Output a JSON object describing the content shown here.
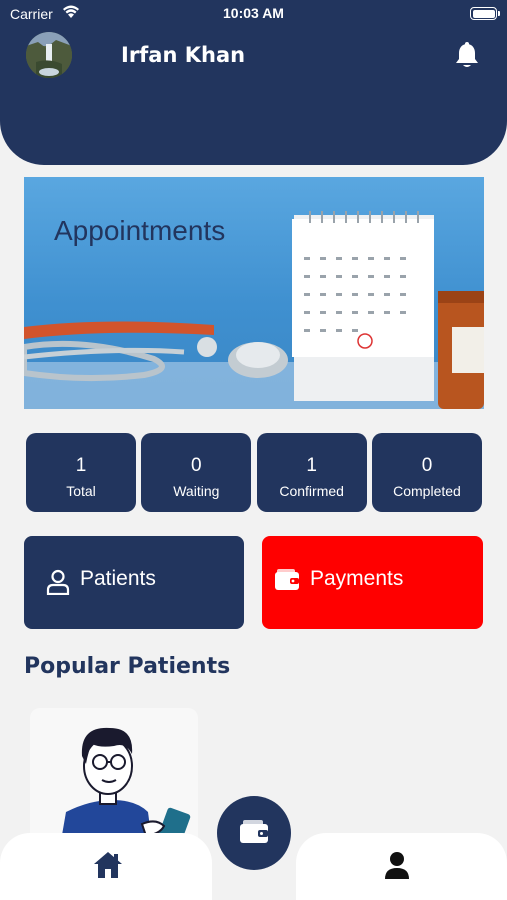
{
  "status_bar": {
    "carrier": "Carrier",
    "time": "10:03 AM"
  },
  "header": {
    "user_name": "Irfan Khan"
  },
  "banner": {
    "title": "Appointments"
  },
  "stats": [
    {
      "value": "1",
      "label": "Total"
    },
    {
      "value": "0",
      "label": "Waiting"
    },
    {
      "value": "1",
      "label": "Confirmed"
    },
    {
      "value": "0",
      "label": "Completed"
    }
  ],
  "actions": {
    "patients_label": "Patients",
    "payments_label": "Payments"
  },
  "section": {
    "popular_patients_title": "Popular Patients"
  },
  "colors": {
    "primary": "#22355e",
    "accent": "#ff0000",
    "background": "#f2f2f2"
  },
  "icons": [
    "wifi-icon",
    "battery-icon",
    "avatar",
    "bell-icon",
    "user-icon",
    "wallet-icon",
    "home-icon",
    "profile-icon"
  ]
}
